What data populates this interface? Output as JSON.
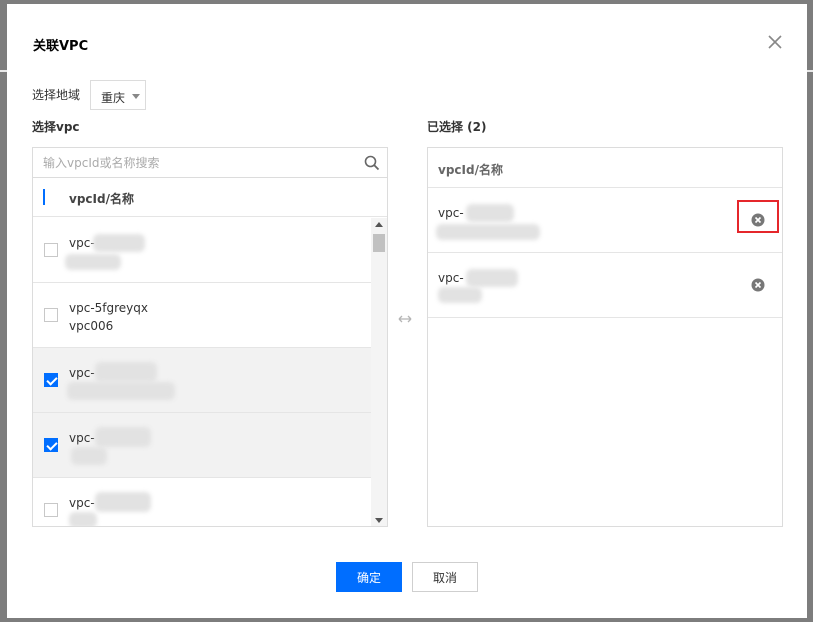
{
  "dialog": {
    "title": "关联VPC",
    "close_icon": "close-icon"
  },
  "region": {
    "label": "选择地域",
    "selected": "重庆"
  },
  "left": {
    "section_label": "选择vpc",
    "search_placeholder": "输入vpcId或名称搜索",
    "header_label": "vpcId/名称",
    "header_checkbox_state": "partial",
    "rows": [
      {
        "id": "vpc-",
        "name": "",
        "checked": false
      },
      {
        "id": "vpc-5fgreyqx",
        "name": "vpc006",
        "checked": false
      },
      {
        "id": "vpc-",
        "name": "",
        "checked": true
      },
      {
        "id": "vpc-",
        "name": "",
        "checked": true
      },
      {
        "id": "vpc-",
        "name": "",
        "checked": false
      }
    ]
  },
  "right": {
    "section_label": "已选择 (2)",
    "header_label": "vpcId/名称",
    "rows": [
      {
        "id": "vpc-",
        "remove_icon": "remove-circle-icon"
      },
      {
        "id": "vpc-",
        "remove_icon": "remove-circle-icon"
      }
    ]
  },
  "footer": {
    "ok_label": "确定",
    "cancel_label": "取消"
  },
  "colors": {
    "primary": "#006eff",
    "highlight": "#e5262b",
    "selected_row": "#f2f2f2"
  }
}
